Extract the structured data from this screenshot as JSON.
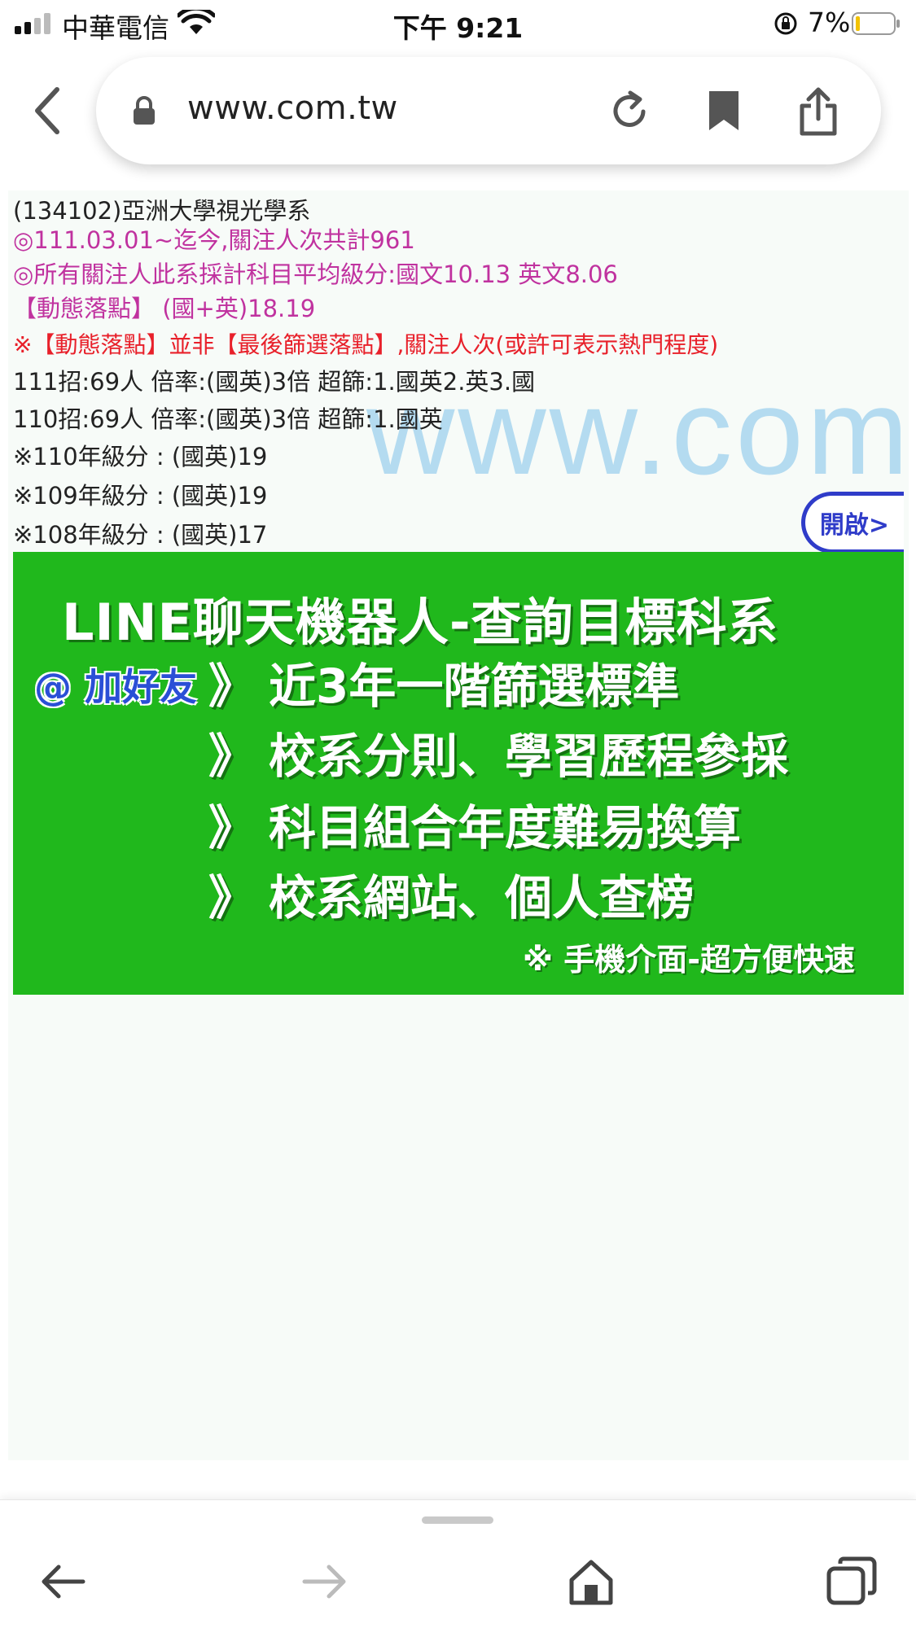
{
  "status_bar": {
    "carrier": "中華電信",
    "time": "下午 9:21",
    "battery": "7%",
    "icons": [
      "signal-icon",
      "wifi-icon",
      "rotation-lock-icon",
      "battery-icon"
    ]
  },
  "address_bar": {
    "url": "www.com.tw",
    "icons": [
      "back-chevron-icon",
      "lock-icon",
      "reload-icon",
      "bookmark-icon",
      "share-icon"
    ]
  },
  "info": {
    "department": "(134102)亞洲大學視光學系",
    "period": "◎111.03.01~迄今,關注人次共計961",
    "average": "◎所有關注人此系採計科目平均級分:國文10.13 英文8.06",
    "dynamic": "【動態落點】 (國+英)18.19",
    "note": "※【動態落點】並非【最後篩選落點】,關注人次(或許可表示熱門程度)",
    "y111": "111招:69人 倍率:(國英)3倍 超篩:1.國英2.英3.國",
    "y110": "110招:69人 倍率:(國英)3倍 超篩:1.國英",
    "g110": "※110年級分 : (國英)19",
    "g109": "※109年級分 : (國英)19",
    "g108": "※108年級分 : (國英)17",
    "watermark": "www.com.tw",
    "open_button": "開啟>"
  },
  "banner": {
    "title": "LINE聊天機器人-查詢目標科系",
    "add_friend": "@ 加好友",
    "chevron": "》",
    "features": [
      "近3年一階篩選標準",
      "校系分則、學習歷程參採",
      "科目組合年度難易換算",
      "校系網站、個人查榜"
    ],
    "footer": "※ 手機介面-超方便快速"
  },
  "toolbar": {
    "icons": [
      "back-arrow-icon",
      "forward-arrow-icon",
      "home-icon",
      "tabs-icon"
    ]
  }
}
